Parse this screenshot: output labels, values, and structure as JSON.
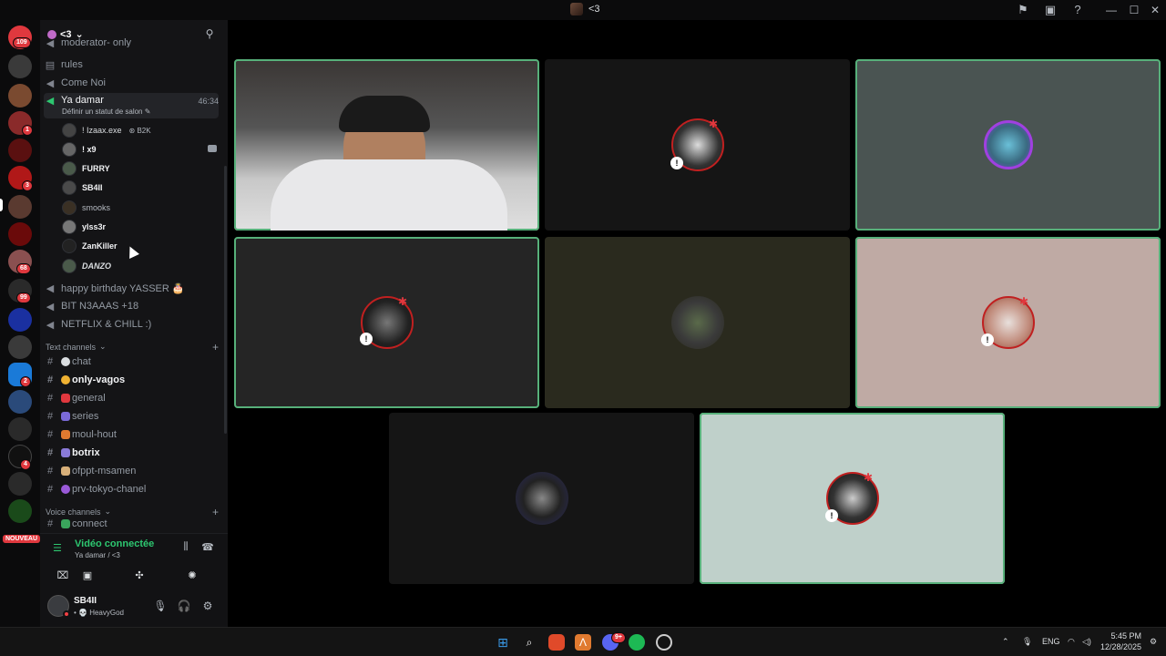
{
  "window": {
    "title": "<3"
  },
  "titlebar_icons": [
    "inbox-flag-icon",
    "screen-share-icon",
    "help-icon"
  ],
  "window_controls": {
    "minimize": "—",
    "maximize": "☐",
    "close": "✕"
  },
  "rail": {
    "home_badge": "109",
    "badges": [
      {
        "text": "1"
      },
      {
        "text": "3"
      },
      {
        "text": "68"
      },
      {
        "text": "99"
      },
      {
        "text": "2"
      },
      {
        "text": "4"
      }
    ],
    "new_label": "NOUVEAU"
  },
  "server": {
    "name": "<3"
  },
  "channels": {
    "partial_top": "moderator- only",
    "rules": "rules",
    "come_noi": "Come Noi",
    "active": {
      "name": "Ya damar",
      "timer": "46:34",
      "status_prompt": "Définir un statut de salon ✎"
    },
    "users": [
      {
        "name": "! Izaax.exe",
        "tag": "⊛ B2K"
      },
      {
        "name": "! x9"
      },
      {
        "name": "FURRY"
      },
      {
        "name": "SB4II"
      },
      {
        "name": "smooks"
      },
      {
        "name": "ylss3r"
      },
      {
        "name": "ZanKiller"
      },
      {
        "name": "DANZO"
      }
    ],
    "voice_after": [
      {
        "name": "happy birthday YASSER 🎂"
      },
      {
        "name": "BIT N3AAAS +18"
      },
      {
        "name": "NETFLIX & CHILL :)"
      }
    ],
    "text_category": "Text channels",
    "text": [
      {
        "name": "chat"
      },
      {
        "name": "only-vagos"
      },
      {
        "name": "general"
      },
      {
        "name": "series"
      },
      {
        "name": "moul-hout"
      },
      {
        "name": "botrix"
      },
      {
        "name": "ofppt-msamen"
      },
      {
        "name": "prv-tokyo-chanel"
      }
    ],
    "voice_category": "Voice channels",
    "voice_first": "connect"
  },
  "voice_panel": {
    "status": "Vidéo connectée",
    "location": "Ya damar / <3"
  },
  "userbar": {
    "name": "SB4II",
    "status": "• 💀 HeavyGod"
  },
  "tiles": [
    {
      "kind": "video"
    },
    {
      "kind": "avatar"
    },
    {
      "kind": "avatar"
    },
    {
      "kind": "avatar"
    },
    {
      "kind": "avatar"
    },
    {
      "kind": "avatar"
    },
    {
      "kind": "avatar"
    },
    {
      "kind": "avatar"
    }
  ],
  "taskbar": {
    "discord_badge": "9+",
    "lang": "ENG",
    "time": "5:45 PM",
    "date": "12/28/2025"
  },
  "colors": {
    "accent": "#57b07a",
    "connected": "#2dc770",
    "alert": "#e0383e"
  }
}
